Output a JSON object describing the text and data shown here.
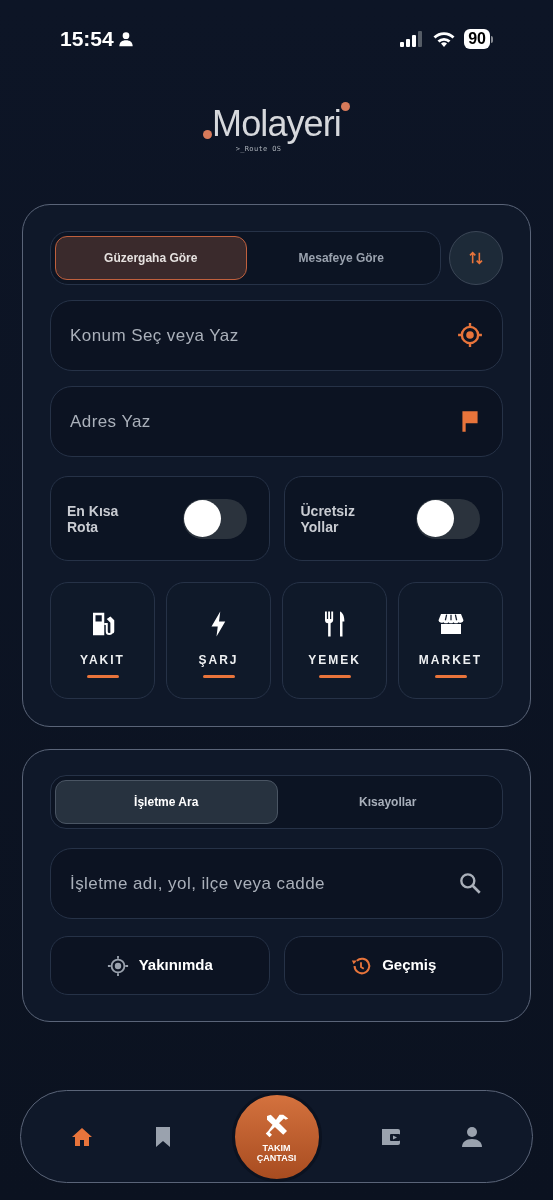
{
  "status_bar": {
    "time": "15:54",
    "battery": "90"
  },
  "logo": {
    "name": "Molayeri",
    "tagline": ">_Route OS"
  },
  "route_modes": [
    {
      "label": "Güzergaha Göre",
      "selected": true
    },
    {
      "label": "Mesafeye Göre",
      "selected": false
    }
  ],
  "start_field": {
    "placeholder": "Konum Seç veya Yaz"
  },
  "destination_field": {
    "placeholder": "Adres Yaz"
  },
  "options": [
    {
      "label": "En Kısa Rota",
      "on": false
    },
    {
      "label": "Ücretsiz Yollar",
      "on": false
    }
  ],
  "categories": [
    {
      "label": "YAKIT",
      "kind": "fuel"
    },
    {
      "label": "ŞARJ",
      "kind": "charge"
    },
    {
      "label": "YEMEK",
      "kind": "food"
    },
    {
      "label": "MARKET",
      "kind": "market"
    }
  ],
  "search_tabs": [
    {
      "label": "İşletme Ara",
      "selected": true
    },
    {
      "label": "Kısayollar",
      "selected": false
    }
  ],
  "search_field": {
    "placeholder": "İşletme adı, yol, ilçe veya cadde"
  },
  "quick_actions": [
    {
      "label": "Yakınımda",
      "kind": "nearby"
    },
    {
      "label": "Geçmiş",
      "kind": "history"
    }
  ],
  "nav": {
    "items": [
      {
        "kind": "home",
        "selected": true
      },
      {
        "kind": "bookmark",
        "selected": false
      },
      {
        "kind": "toolkit",
        "label": "TAKIM ÇANTASI"
      },
      {
        "kind": "wallet",
        "selected": false
      },
      {
        "kind": "profile",
        "selected": false
      }
    ]
  }
}
